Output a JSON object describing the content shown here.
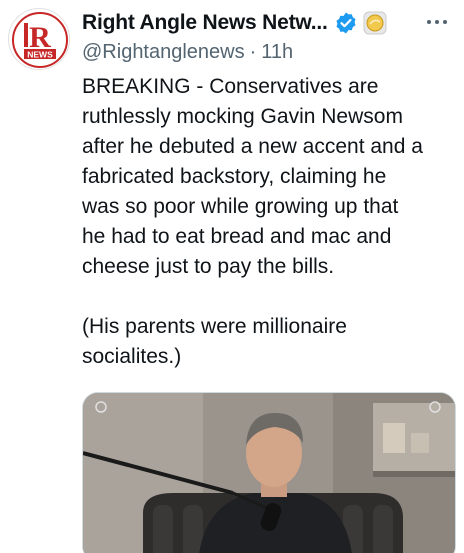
{
  "account": {
    "display_name": "Right Angle News Netw...",
    "handle": "@Rightanglenews",
    "separator": "·",
    "time": "11h",
    "avatar_logo_text": "R NEWS",
    "verified_color": "#1d9bf0",
    "affiliate_color": "#f2c94c"
  },
  "tweet": {
    "line1": "BREAKING - Conservatives are",
    "line2": "ruthlessly mocking Gavin Newsom",
    "line3": "after he debuted a new accent and a",
    "line4": "fabricated backstory, claiming he",
    "line5": "was so poor while growing up that",
    "line6": "he had to eat bread and mac and",
    "line7": "cheese just to pay the bills.",
    "line8": "(His parents were millionaire",
    "line9": "socialites.)"
  },
  "icons": {
    "more": "more-options-icon",
    "verified": "verified-badge-icon",
    "affiliate": "affiliate-badge-icon"
  }
}
